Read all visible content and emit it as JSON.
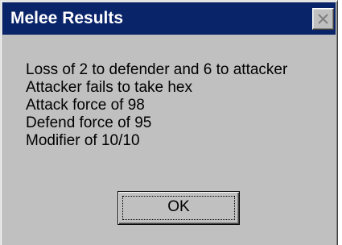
{
  "window": {
    "title": "Melee Results",
    "close_icon": "close-icon",
    "titlebar_color": "#0a246a",
    "face_color": "#c0c0c0"
  },
  "message": {
    "lines": [
      "Loss of 2 to defender and 6 to attacker",
      "Attacker fails to take hex",
      "Attack force of 98",
      "Defend force of 95",
      "Modifier of 10/10"
    ]
  },
  "buttons": {
    "ok_label": "OK"
  }
}
